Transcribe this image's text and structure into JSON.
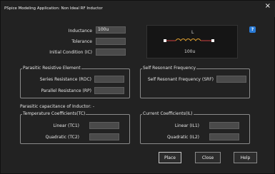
{
  "window": {
    "title": "PSpice Modeling Application: Non Ideal RF Inductor",
    "close_glyph": "×"
  },
  "main": {
    "inductance": {
      "label": "Inductance",
      "value": "100u"
    },
    "tolerance": {
      "label": "Tolerance",
      "value": ""
    },
    "initial_condition": {
      "label": "Initial Condition (IC)",
      "value": ""
    }
  },
  "preview": {
    "ref_label": "L",
    "value_label": "100u",
    "colors": {
      "coil": "#e0a030",
      "terminal": "#d04040",
      "pin": "#ffffff",
      "text": "#dddddd"
    }
  },
  "help_icon": {
    "name": "help-icon",
    "glyph": "?"
  },
  "parasitic_resistive": {
    "title": "Parasitic Resistive Element",
    "series": {
      "label": "Series Resistance (RDC)",
      "value": ""
    },
    "parallel": {
      "label": "Parallel Resistance (RP)",
      "value": ""
    }
  },
  "self_resonant": {
    "title": "Self Resonant Frequency",
    "srf": {
      "label": "Self Resonant Frequency (SRF)",
      "value": ""
    }
  },
  "parasitic_capacitance_text": "Parasitic capacitance of Inductor: -",
  "temperature": {
    "title": "Temperature Coefficients(TC)",
    "linear": {
      "label": "Linear (TC1)",
      "value": ""
    },
    "quadratic": {
      "label": "Quadratic (TC2)",
      "value": ""
    }
  },
  "current": {
    "title": "Current Coefficients(IL)",
    "linear": {
      "label": "Linear (IL1)",
      "value": ""
    },
    "quadratic": {
      "label": "Quadratic (IL2)",
      "value": ""
    }
  },
  "buttons": {
    "place": "Place",
    "close": "Close",
    "help": "Help"
  }
}
